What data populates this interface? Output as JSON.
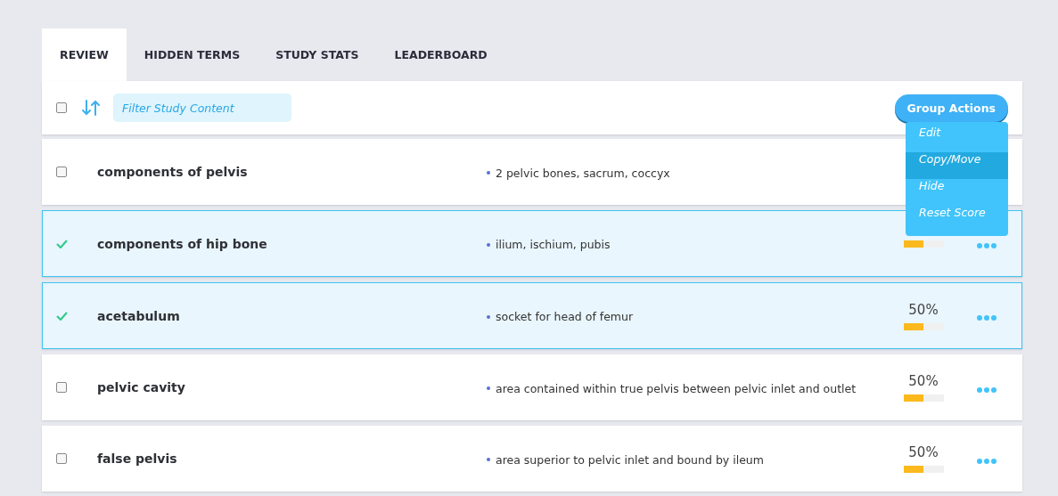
{
  "tabs": [
    {
      "label": "REVIEW",
      "selected": true
    },
    {
      "label": "HIDDEN TERMS",
      "selected": false
    },
    {
      "label": "STUDY STATS",
      "selected": false
    },
    {
      "label": "LEADERBOARD",
      "selected": false
    }
  ],
  "toolbar": {
    "select_all_checked": false,
    "filter": {
      "placeholder": "Filter Study Content"
    },
    "group_actions": {
      "label": "Group Actions",
      "expanded": true,
      "menu": [
        {
          "label": "Edit",
          "selected": false
        },
        {
          "label": "Copy/Move",
          "selected": true
        },
        {
          "label": "Hide",
          "selected": false
        },
        {
          "label": "Reset Score",
          "selected": false
        }
      ]
    }
  },
  "rows": [
    {
      "term": "components of pelvis",
      "definition": "2 pelvic bones, sacrum, coccyx",
      "selected": false
    },
    {
      "term": "components of hip bone",
      "definition": "ilium, ischium, pubis",
      "selected": true,
      "level": 0.5
    },
    {
      "term": "acetabulum",
      "definition": "socket for head of femur",
      "selected": true,
      "score": "50%",
      "level": 0.5
    },
    {
      "term": "pelvic cavity",
      "definition": "area contained within true pelvis between pelvic inlet and outlet",
      "selected": false,
      "score": "50%",
      "level": 0.5
    },
    {
      "term": "false pelvis",
      "definition": "area superior to pelvic inlet and bound by ileum",
      "selected": false,
      "score": "50%",
      "level": 0.5
    }
  ]
}
